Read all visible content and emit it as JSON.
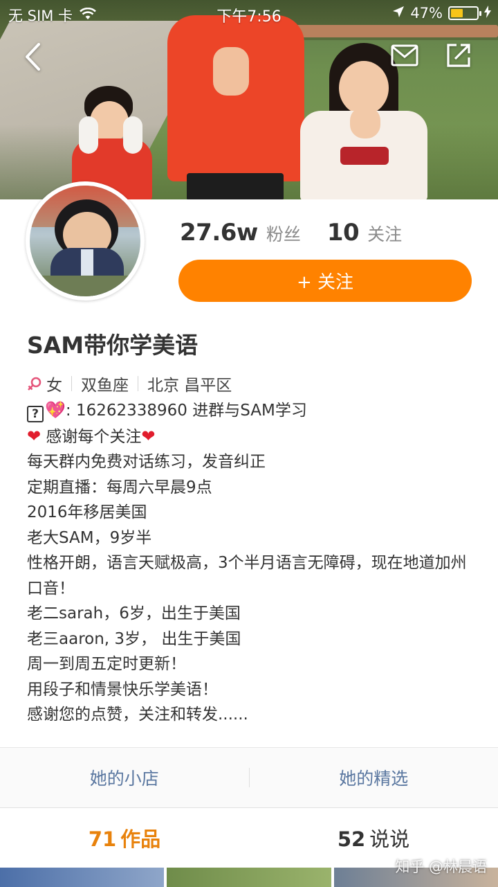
{
  "status_bar": {
    "carrier": "无 SIM 卡",
    "time": "下午7:56",
    "battery": "47%",
    "battery_level": 0.47
  },
  "nav": {
    "back_icon": "chevron-left-icon",
    "message_icon": "envelope-icon",
    "share_icon": "share-icon"
  },
  "profile": {
    "fans_count": "27.6w",
    "fans_label": "粉丝",
    "following_count": "10",
    "following_label": "关注",
    "follow_button": "+ 关注",
    "nickname": "SAM带你学美语",
    "gender_icon": "female-icon",
    "gender": "女",
    "zodiac": "双鱼座",
    "location": "北京 昌平区"
  },
  "bio": {
    "line1_prefix": ": 16262338960 进群与SAM学习",
    "line2": "感谢每个关注",
    "line3": "每天群内免费对话练习，发音纠正",
    "line4": "定期直播：每周六早晨9点",
    "line5": "2016年移居美国",
    "line6": "老大SAM，9岁半",
    "line7": "性格开朗，语言天赋极高，3个半月语言无障碍，现在地道加州口音！",
    "line8": "老二sarah，6岁，出生于美国",
    "line9": "老三aaron, 3岁， 出生于美国",
    "line10": "周一到周五定时更新！",
    "line11": "用段子和情景快乐学美语！",
    "line12": "感谢您的点赞，关注和转发......"
  },
  "shop_links": {
    "shop": "她的小店",
    "picks": "她的精选"
  },
  "tabs": {
    "works_count": "71",
    "works_label": "作品",
    "posts_count": "52",
    "posts_label": "说说"
  },
  "watermark": "知乎 @林晨语",
  "colors": {
    "accent": "#ff8200",
    "active_tab": "#e8820c",
    "link": "#5a77a0"
  }
}
